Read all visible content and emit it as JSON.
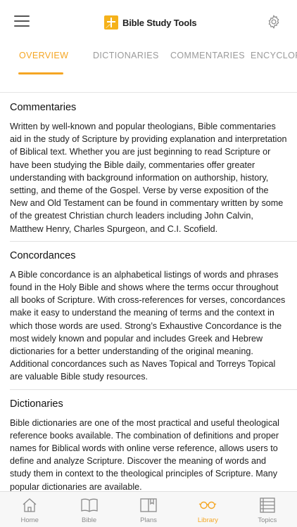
{
  "header": {
    "title": "Bible Study Tools"
  },
  "tabs": [
    {
      "label": "OVERVIEW"
    },
    {
      "label": "DICTIONARIES"
    },
    {
      "label": "COMMENTARIES"
    },
    {
      "label": "ENCYCLOPEDIAS"
    }
  ],
  "sections": [
    {
      "title": "Commentaries",
      "body": "Written by well-known and popular theologians, Bible commentaries aid in the study of Scripture by providing explanation and interpretation of Biblical text. Whether you are just beginning to read Scripture or have been studying the Bible daily, commentaries offer greater understanding with background information on authorship, history, setting, and theme of the Gospel. Verse by verse exposition of the New and Old Testament can be found in commentary written by some of the greatest Christian church leaders including John Calvin, Matthew Henry, Charles Spurgeon, and C.I. Scofield."
    },
    {
      "title": "Concordances",
      "body": "A Bible concordance is an alphabetical listings of words and phrases found in the Holy Bible and shows where the terms occur throughout all books of Scripture. With cross-references for verses, concordances make it easy to understand the meaning of terms and the context in which those words are used. Strong’s Exhaustive Concordance is the most widely known and popular and includes Greek and Hebrew dictionaries for a better understanding of the original meaning. Additional concordances such as Naves Topical and Torreys Topical are valuable Bible study resources."
    },
    {
      "title": "Dictionaries",
      "body": "Bible dictionaries are one of the most practical and useful theological reference books available. The combination of definitions and proper names for Biblical words with online verse reference, allows users to define and analyze Scripture. Discover the meaning of words and study them in context to the theological principles of Scripture. Many popular dictionaries are available."
    }
  ],
  "bottom_nav": [
    {
      "label": "Home",
      "icon": "home-icon"
    },
    {
      "label": "Bible",
      "icon": "book-open-icon"
    },
    {
      "label": "Plans",
      "icon": "plans-book-icon"
    },
    {
      "label": "Library",
      "icon": "glasses-icon"
    },
    {
      "label": "Topics",
      "icon": "list-icon"
    }
  ],
  "colors": {
    "accent": "#f5a623",
    "logo": "#f5b21b",
    "inactive": "#9a9a9a"
  }
}
